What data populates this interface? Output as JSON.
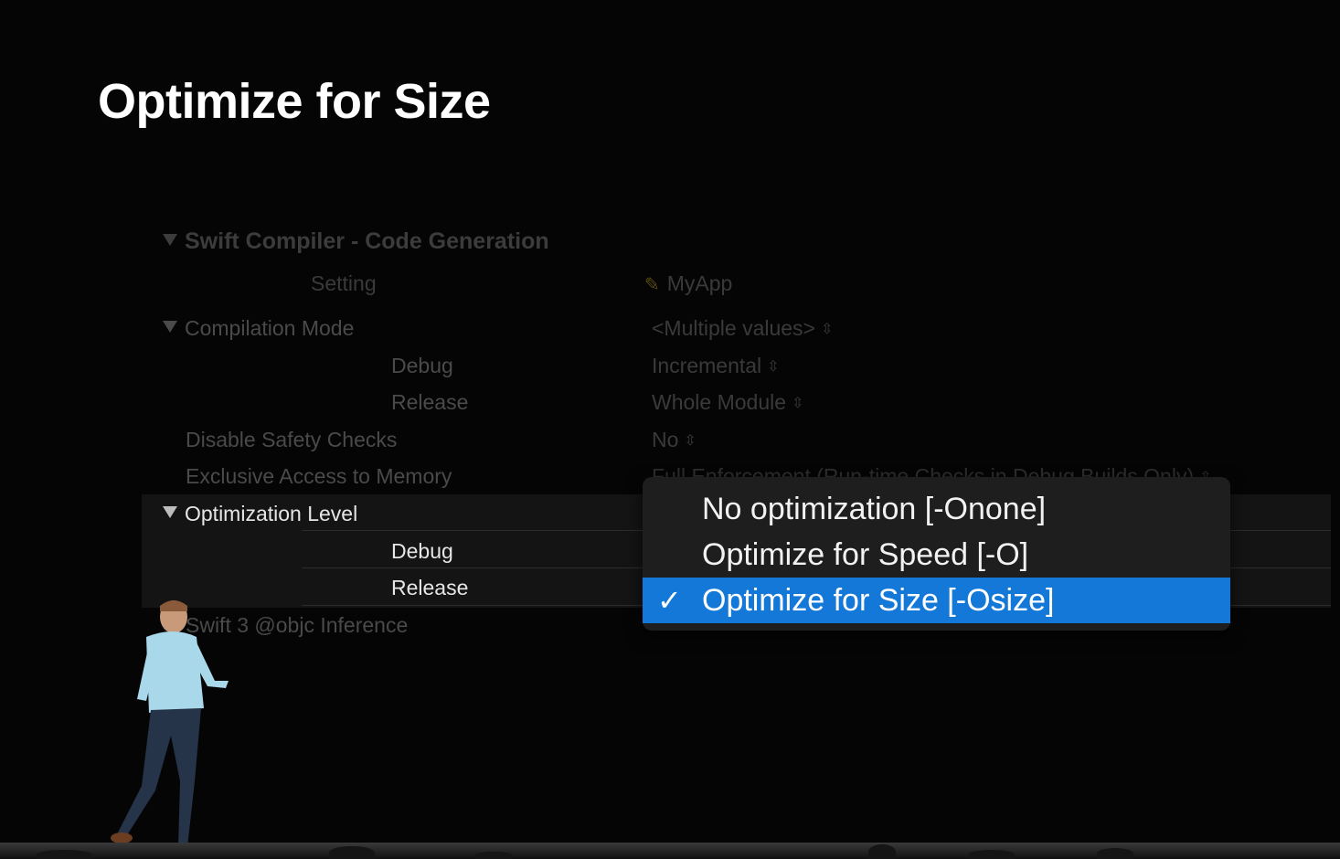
{
  "slide": {
    "title": "Optimize for Size"
  },
  "settings": {
    "section_title": "Swift Compiler - Code Generation",
    "column_setting": "Setting",
    "column_target": "MyApp",
    "rows": {
      "compilation_mode": {
        "label": "Compilation Mode",
        "value": "<Multiple values>"
      },
      "compilation_debug": {
        "label": "Debug",
        "value": "Incremental"
      },
      "compilation_release": {
        "label": "Release",
        "value": "Whole Module"
      },
      "disable_safety": {
        "label": "Disable Safety Checks",
        "value": "No"
      },
      "exclusive_access": {
        "label": "Exclusive Access to Memory",
        "value": "Full Enforcement (Run-time Checks in Debug Builds Only)"
      },
      "optimization_level": {
        "label": "Optimization Level"
      },
      "optimization_debug": {
        "label": "Debug"
      },
      "optimization_release": {
        "label": "Release"
      },
      "objc_inference": {
        "label": "Swift 3 @objc Inference"
      }
    }
  },
  "popup": {
    "items": [
      {
        "label": "No optimization [-Onone]",
        "selected": false
      },
      {
        "label": "Optimize for Speed [-O]",
        "selected": false
      },
      {
        "label": "Optimize for Size [-Osize]",
        "selected": true
      }
    ],
    "check_glyph": "✓",
    "accent_color": "#1478d8"
  }
}
